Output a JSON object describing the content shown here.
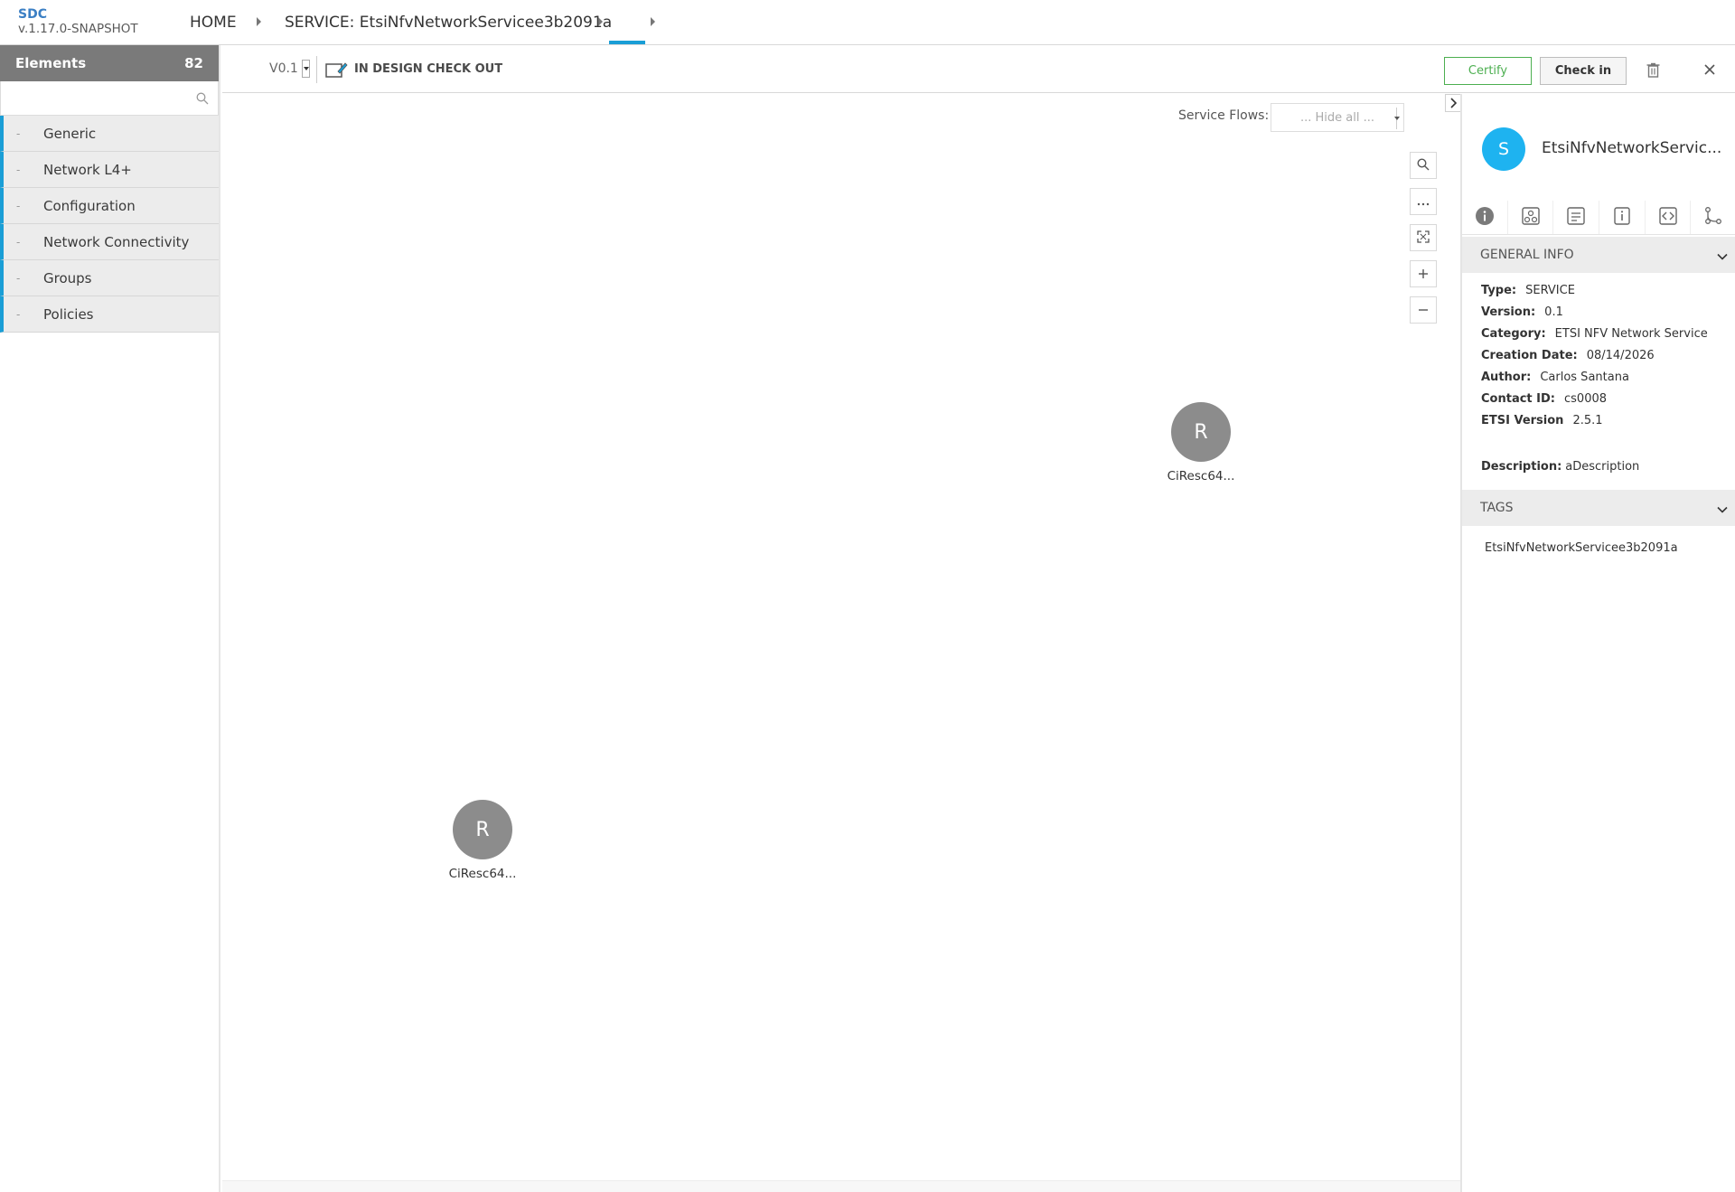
{
  "app": {
    "logo_name": "SDC",
    "logo_version": "v.1.17.0-SNAPSHOT"
  },
  "breadcrumb": {
    "home": "HOME",
    "service": "SERVICE: EtsiNfvNetworkServicee3b2091a",
    "current": ""
  },
  "palette": {
    "title": "Elements",
    "count": "82",
    "search_placeholder": "",
    "categories": [
      {
        "label": "Generic"
      },
      {
        "label": "Network L4+"
      },
      {
        "label": "Configuration"
      },
      {
        "label": "Network Connectivity"
      },
      {
        "label": "Groups"
      },
      {
        "label": "Policies"
      }
    ]
  },
  "toolbar": {
    "version": "V0.1",
    "status": "IN DESIGN CHECK OUT",
    "certify_label": "Certify",
    "checkin_label": "Check in"
  },
  "canvas": {
    "service_flows_label": "Service Flows:",
    "service_flows_value": "... Hide all ...",
    "zoom_controls": [
      "search-icon",
      "more-icon",
      "fit-icon",
      "zoom-in-icon",
      "zoom-out-icon"
    ],
    "nodes": [
      {
        "letter": "R",
        "label": "CiResc64..."
      },
      {
        "letter": "R",
        "label": "CiResc64..."
      }
    ]
  },
  "panel": {
    "avatar_letter": "S",
    "title": "EtsiNfvNetworkServic...",
    "tabs": [
      "info-icon",
      "composition-icon",
      "deployment-artifacts-icon",
      "properties-icon",
      "tosca-artifacts-icon",
      "service-paths-icon"
    ],
    "general_info": {
      "heading": "GENERAL INFO",
      "rows": [
        {
          "key": "Type:",
          "value": "SERVICE"
        },
        {
          "key": "Version:",
          "value": "0.1"
        },
        {
          "key": "Category:",
          "value": "ETSI NFV Network Service"
        },
        {
          "key": "Creation Date:",
          "value": "08/14/2026"
        },
        {
          "key": "Author:",
          "value": "Carlos Santana"
        },
        {
          "key": "Contact ID:",
          "value": "cs0008"
        },
        {
          "key": "ETSI Version",
          "value": "2.5.1"
        }
      ],
      "description_key": "Description:",
      "description_value": "aDescription"
    },
    "tags": {
      "heading": "TAGS",
      "items": [
        "EtsiNfvNetworkServicee3b2091a"
      ]
    }
  },
  "colors": {
    "accent": "#1a9ed6",
    "certify": "#4caf50",
    "avatar": "#1eb3f0",
    "node": "#8c8c8c",
    "palette_header": "#7a7a7a"
  }
}
